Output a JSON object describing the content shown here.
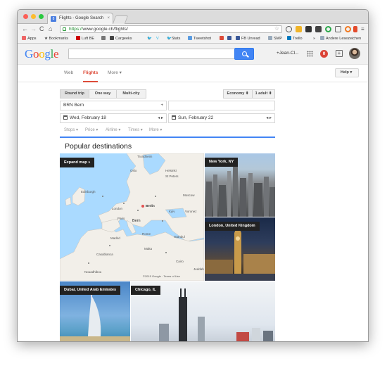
{
  "browser": {
    "tab_title": "Flights - Google Search",
    "tab_close": "×",
    "url_scheme": "https://",
    "url_rest": "www.google.ch/flights/",
    "bookmarks": [
      "Apps",
      "Bookmarks",
      "Luft BE",
      "Cargeeks",
      "Stats",
      "Tweetshot",
      "FB Unread",
      "SMP",
      "Trello",
      "Andere Lesezeichen"
    ],
    "bookmarks_more": "»"
  },
  "google": {
    "logo": "Google",
    "user": "+Jean-Cl...",
    "notifications": "0",
    "share": "+"
  },
  "subnav": {
    "web": "Web",
    "flights": "Flights",
    "more": "More ▾",
    "help": "Help ▾"
  },
  "search": {
    "trip_types": [
      "Round trip",
      "One way",
      "Multi-city"
    ],
    "cabin": "Economy  ⬍",
    "passengers": "1 adult  ⬍",
    "origin": "BRN Bern",
    "origin_add": "+",
    "destination": "",
    "depart": "Wed, February 18",
    "return": "Sun, February 22",
    "date_nav": "◂  ▸",
    "filters": [
      "Stops ▾",
      "Price ▾",
      "Airline ▾",
      "Times ▾",
      "More ▾"
    ]
  },
  "popular": {
    "title": "Popular destinations",
    "expand_map": "Expand map »",
    "map_credit": "©2015 Google · Terms of Use",
    "map_labels": [
      "Trondheim",
      "Helsinki",
      "St Peters",
      "Oslo",
      "Moscow",
      "Edinburgh",
      "Berlin",
      "Voronez",
      "London",
      "Paris",
      "Kyiv",
      "Bern",
      "Madrid",
      "Rome",
      "Istanbul",
      "Malta",
      "Casablanca",
      "Cairo",
      "Nouadhibou",
      "Jeddah"
    ],
    "destinations": [
      "New York, NY",
      "London, United Kingdom",
      "Dubai, United Arab Emirates",
      "Chicago, IL"
    ]
  }
}
